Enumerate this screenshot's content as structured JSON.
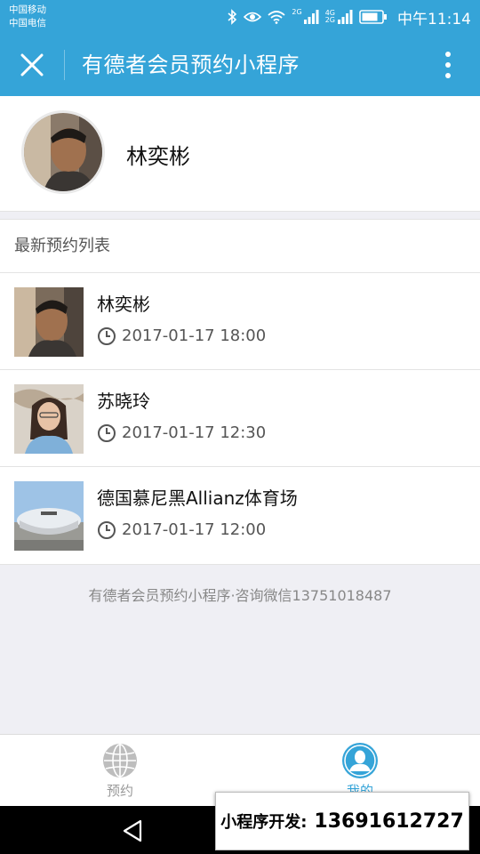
{
  "status_bar": {
    "carrier_1": "中国移动",
    "carrier_2": "中国电信",
    "network_1": "2G",
    "network_2": "4G",
    "network_3": "2G",
    "time": "中午11:14"
  },
  "title_bar": {
    "title": "有德者会员预约小程序"
  },
  "profile": {
    "name": "林奕彬"
  },
  "list": {
    "header": "最新预约列表",
    "items": [
      {
        "name": "林奕彬",
        "time": "2017-01-17 18:00"
      },
      {
        "name": "苏晓玲",
        "time": "2017-01-17 12:30"
      },
      {
        "name": "德国慕尼黑Allianz体育场",
        "time": "2017-01-17 12:00"
      }
    ]
  },
  "footer_note": "有德者会员预约小程序·咨询微信13751018487",
  "tab_bar": {
    "tabs": [
      {
        "label": "预约",
        "icon": "globe-icon",
        "active": false
      },
      {
        "label": "我的",
        "icon": "user-icon",
        "active": true
      }
    ]
  },
  "overlay": {
    "label": "小程序开发:",
    "phone": "13691612727"
  },
  "colors": {
    "brand": "#35a4d8",
    "background": "#efeff4"
  }
}
